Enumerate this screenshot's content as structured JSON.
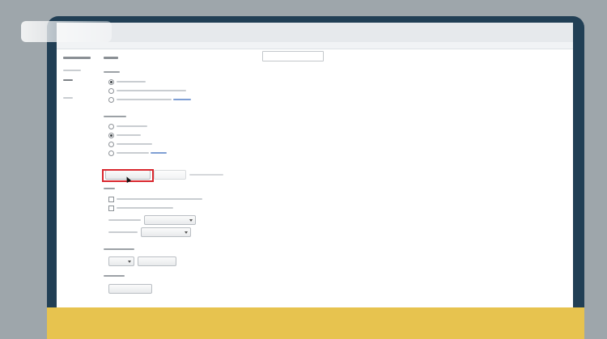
{
  "caption": {
    "text": ""
  },
  "colors": {
    "monitor": "#213f55",
    "caption_bg": "#e7c34f",
    "highlight": "#d9282f",
    "background": "#9ea6ab"
  },
  "icons": [
    "cursor-pointer-icon"
  ],
  "settings": {
    "startup": {
      "selected_index": 0,
      "option_count": 3
    },
    "adblock": {
      "selected_index": 1,
      "option_count": 4
    },
    "tabs": {
      "checkbox_count": 2,
      "select_count": 2
    },
    "search_engine": {
      "select_count": 1,
      "button_count": 1
    }
  }
}
